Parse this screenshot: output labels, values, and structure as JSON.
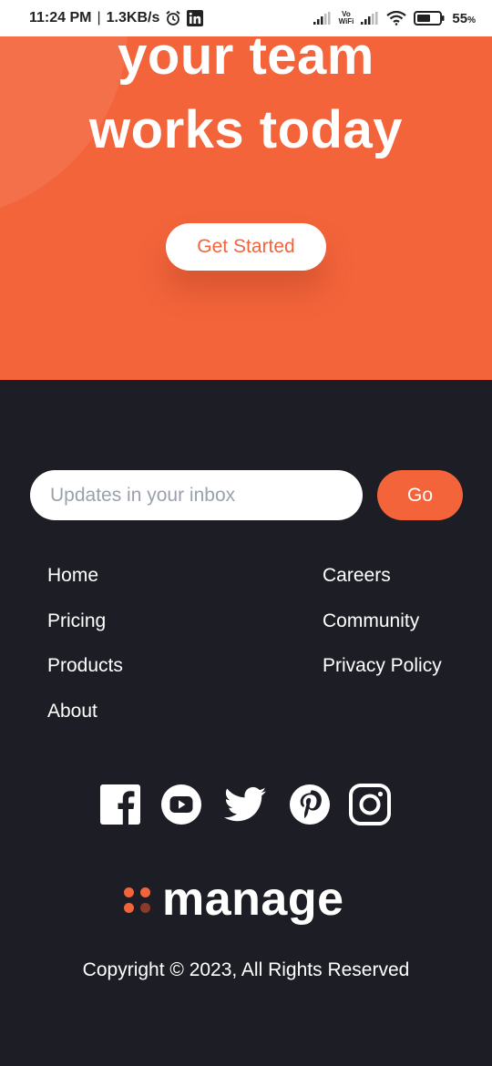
{
  "status_bar": {
    "time": "11:24 PM",
    "separator": "|",
    "net_speed": "1.3KB/s",
    "vowifi_top": "Vo",
    "vowifi_bottom": "WiFi",
    "battery": "55",
    "battery_unit": "%",
    "icons": [
      "alarm-icon",
      "linkedin-icon",
      "signal-icon",
      "vowifi-icon",
      "wifi-icon",
      "battery-icon"
    ]
  },
  "hero": {
    "title_line1": "your team",
    "title_line2": "works today",
    "cta_label": "Get Started"
  },
  "newsletter": {
    "placeholder": "Updates in your inbox",
    "value": "",
    "submit_label": "Go"
  },
  "footer": {
    "links_left": [
      "Home",
      "Pricing",
      "Products",
      "About"
    ],
    "links_right": [
      "Careers",
      "Community",
      "Privacy Policy"
    ],
    "socials": [
      "facebook-icon",
      "youtube-icon",
      "twitter-icon",
      "pinterest-icon",
      "instagram-icon"
    ],
    "logo_text": "manage",
    "copyright": "Copyright © 2023, All Rights Reserved"
  },
  "colors": {
    "accent": "#f3643b",
    "footer_bg": "#1d1e25",
    "white": "#ffffff"
  }
}
